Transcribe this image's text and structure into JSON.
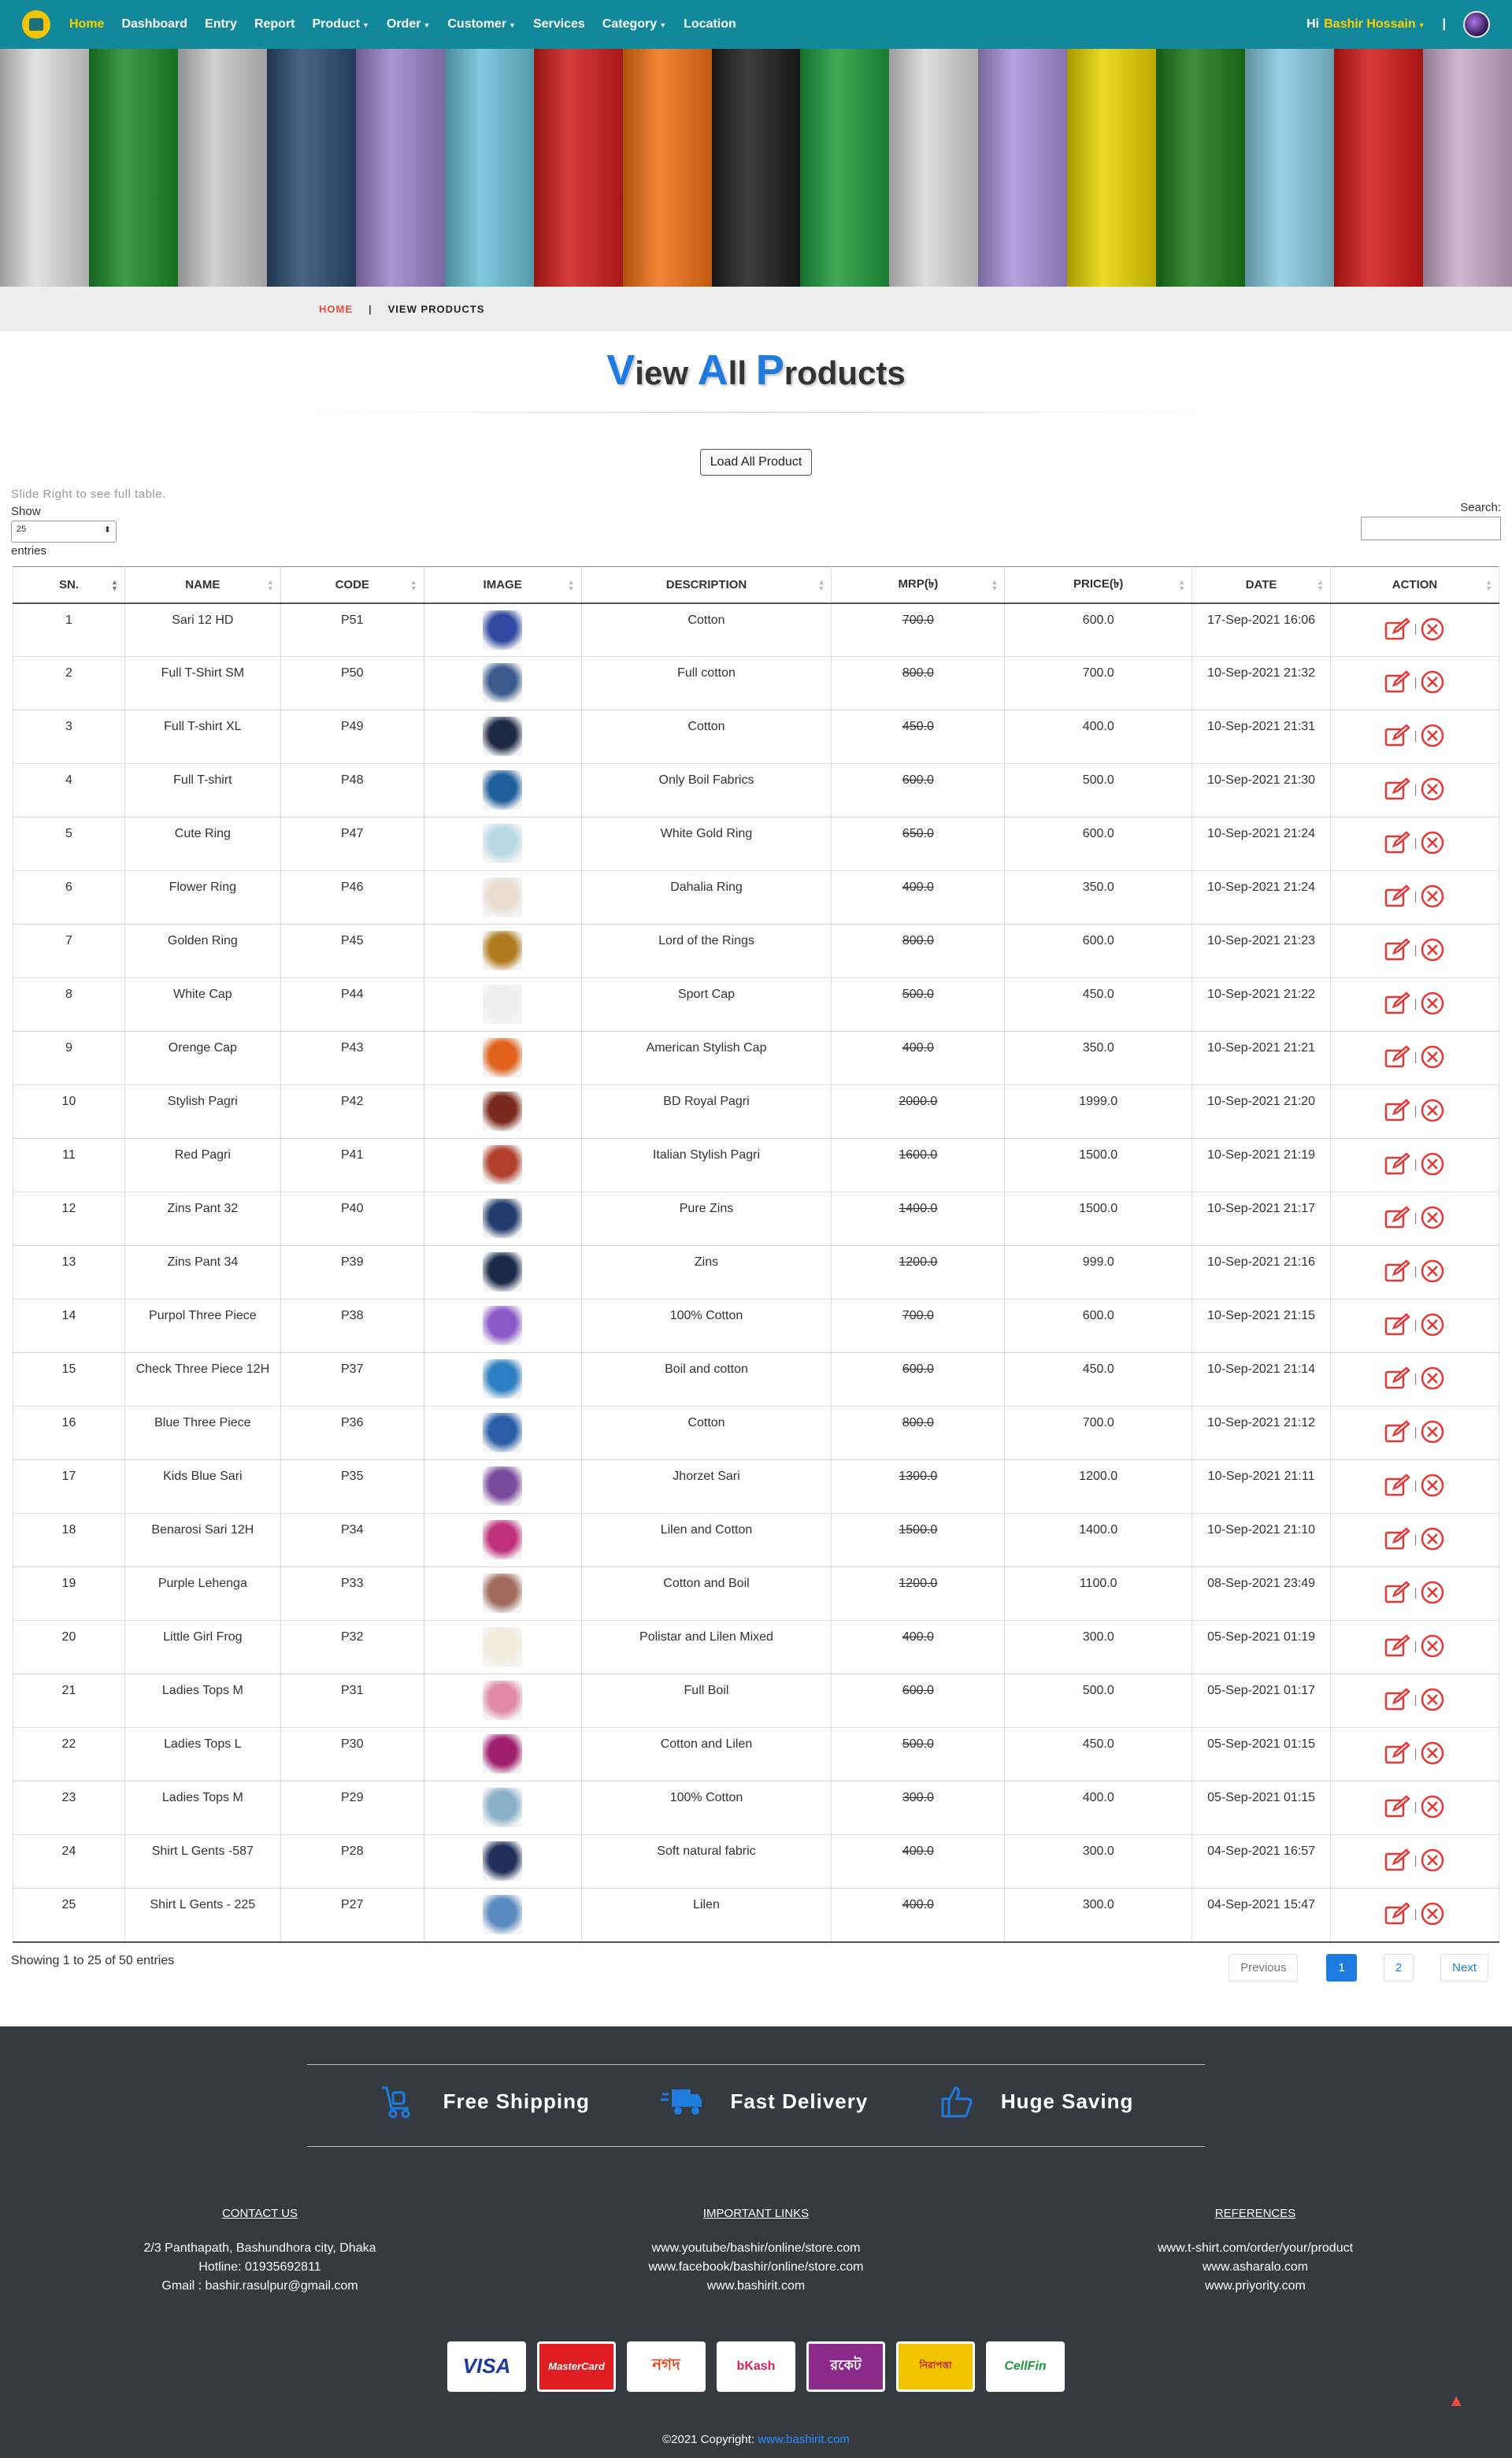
{
  "nav": {
    "items": [
      {
        "label": "Home",
        "active": true,
        "dropdown": false
      },
      {
        "label": "Dashboard",
        "active": false,
        "dropdown": false
      },
      {
        "label": "Entry",
        "active": false,
        "dropdown": false
      },
      {
        "label": "Report",
        "active": false,
        "dropdown": false
      },
      {
        "label": "Product",
        "active": false,
        "dropdown": true
      },
      {
        "label": "Order",
        "active": false,
        "dropdown": true
      },
      {
        "label": "Customer",
        "active": false,
        "dropdown": true
      },
      {
        "label": "Services",
        "active": false,
        "dropdown": false
      },
      {
        "label": "Category",
        "active": false,
        "dropdown": true
      },
      {
        "label": "Location",
        "active": false,
        "dropdown": false
      }
    ],
    "greeting": "Hi",
    "user": "Bashir Hossain",
    "separator": "|"
  },
  "breadcrumb": {
    "home": "HOME",
    "sep": "|",
    "current": "VIEW PRODUCTS"
  },
  "title": {
    "w1cap": "V",
    "w1rest": "iew ",
    "w2cap": "A",
    "w2rest": "ll ",
    "w3cap": "P",
    "w3rest": "roducts"
  },
  "load_button": "Load All Product",
  "controls": {
    "hint": "Slide Right to see full table.",
    "show": "Show",
    "length": "25",
    "entries": "entries",
    "search": "Search:"
  },
  "columns": [
    "SN.",
    "NAME",
    "CODE",
    "IMAGE",
    "DESCRIPTION",
    "MRP(৳)",
    "PRICE(৳)",
    "DATE",
    "ACTION"
  ],
  "products": [
    {
      "sn": "1",
      "name": "Sari 12 HD",
      "code": "P51",
      "desc": "Cotton",
      "mrp": "700.0",
      "price": "600.0",
      "date": "17-Sep-2021 16:06",
      "color": "#2f4aa0"
    },
    {
      "sn": "2",
      "name": "Full T-Shirt SM",
      "code": "P50",
      "desc": "Full cotton",
      "mrp": "800.0",
      "price": "700.0",
      "date": "10-Sep-2021 21:32",
      "color": "#3a5b8c"
    },
    {
      "sn": "3",
      "name": "Full T-shirt XL",
      "code": "P49",
      "desc": "Cotton",
      "mrp": "450.0",
      "price": "400.0",
      "date": "10-Sep-2021 21:31",
      "color": "#1e2a44"
    },
    {
      "sn": "4",
      "name": "Full T-shirt",
      "code": "P48",
      "desc": "Only Boil Fabrics",
      "mrp": "600.0",
      "price": "500.0",
      "date": "10-Sep-2021 21:30",
      "color": "#1f5f9c"
    },
    {
      "sn": "5",
      "name": "Cute Ring",
      "code": "P47",
      "desc": "White Gold Ring",
      "mrp": "650.0",
      "price": "600.0",
      "date": "10-Sep-2021 21:24",
      "color": "#b9d9e6"
    },
    {
      "sn": "6",
      "name": "Flower Ring",
      "code": "P46",
      "desc": "Dahalia Ring",
      "mrp": "400.0",
      "price": "350.0",
      "date": "10-Sep-2021 21:24",
      "color": "#e8dccf"
    },
    {
      "sn": "7",
      "name": "Golden Ring",
      "code": "P45",
      "desc": "Lord of the Rings",
      "mrp": "800.0",
      "price": "600.0",
      "date": "10-Sep-2021 21:23",
      "color": "#b07a1e"
    },
    {
      "sn": "8",
      "name": "White Cap",
      "code": "P44",
      "desc": "Sport Cap",
      "mrp": "500.0",
      "price": "450.0",
      "date": "10-Sep-2021 21:22",
      "color": "#eeeeee"
    },
    {
      "sn": "9",
      "name": "Orenge Cap",
      "code": "P43",
      "desc": "American Stylish Cap",
      "mrp": "400.0",
      "price": "350.0",
      "date": "10-Sep-2021 21:21",
      "color": "#e0621c"
    },
    {
      "sn": "10",
      "name": "Stylish Pagri",
      "code": "P42",
      "desc": "BD Royal Pagri",
      "mrp": "2000.0",
      "price": "1999.0",
      "date": "10-Sep-2021 21:20",
      "color": "#7a2a1c"
    },
    {
      "sn": "11",
      "name": "Red Pagri",
      "code": "P41",
      "desc": "Italian Stylish Pagri",
      "mrp": "1600.0",
      "price": "1500.0",
      "date": "10-Sep-2021 21:19",
      "color": "#b0402c"
    },
    {
      "sn": "12",
      "name": "Zins Pant 32",
      "code": "P40",
      "desc": "Pure Zins",
      "mrp": "1400.0",
      "price": "1500.0",
      "date": "10-Sep-2021 21:17",
      "color": "#233e6e"
    },
    {
      "sn": "13",
      "name": "Zins Pant 34",
      "code": "P39",
      "desc": "Zins",
      "mrp": "1200.0",
      "price": "999.0",
      "date": "10-Sep-2021 21:16",
      "color": "#1c2a4a"
    },
    {
      "sn": "14",
      "name": "Purpol Three Piece",
      "code": "P38",
      "desc": "100% Cotton",
      "mrp": "700.0",
      "price": "600.0",
      "date": "10-Sep-2021 21:15",
      "color": "#8a5ac8"
    },
    {
      "sn": "15",
      "name": "Check Three Piece 12H",
      "code": "P37",
      "desc": "Boil and cotton",
      "mrp": "600.0",
      "price": "450.0",
      "date": "10-Sep-2021 21:14",
      "color": "#2b7fc2"
    },
    {
      "sn": "16",
      "name": "Blue Three Piece",
      "code": "P36",
      "desc": "Cotton",
      "mrp": "800.0",
      "price": "700.0",
      "date": "10-Sep-2021 21:12",
      "color": "#2a5fa8"
    },
    {
      "sn": "17",
      "name": "Kids Blue Sari",
      "code": "P35",
      "desc": "Jhorzet Sari",
      "mrp": "1300.0",
      "price": "1200.0",
      "date": "10-Sep-2021 21:11",
      "color": "#7a4a9c"
    },
    {
      "sn": "18",
      "name": "Benarosi Sari 12H",
      "code": "P34",
      "desc": "Lilen and Cotton",
      "mrp": "1500.0",
      "price": "1400.0",
      "date": "10-Sep-2021 21:10",
      "color": "#c0307a"
    },
    {
      "sn": "19",
      "name": "Purple Lehenga",
      "code": "P33",
      "desc": "Cotton and Boil",
      "mrp": "1200.0",
      "price": "1100.0",
      "date": "08-Sep-2021 23:49",
      "color": "#a06a5c"
    },
    {
      "sn": "20",
      "name": "Little Girl Frog",
      "code": "P32",
      "desc": "Polistar and Lilen Mixed",
      "mrp": "400.0",
      "price": "300.0",
      "date": "05-Sep-2021 01:19",
      "color": "#f1ead8"
    },
    {
      "sn": "21",
      "name": "Ladies Tops M",
      "code": "P31",
      "desc": "Full Boil",
      "mrp": "600.0",
      "price": "500.0",
      "date": "05-Sep-2021 01:17",
      "color": "#e08aa8"
    },
    {
      "sn": "22",
      "name": "Ladies Tops L",
      "code": "P30",
      "desc": "Cotton and Lilen",
      "mrp": "500.0",
      "price": "450.0",
      "date": "05-Sep-2021 01:15",
      "color": "#a01e6e"
    },
    {
      "sn": "23",
      "name": "Ladies Tops M",
      "code": "P29",
      "desc": "100% Cotton",
      "mrp": "300.0",
      "price": "400.0",
      "date": "05-Sep-2021 01:15",
      "color": "#8ab0c8"
    },
    {
      "sn": "24",
      "name": "Shirt L Gents -587",
      "code": "P28",
      "desc": "Soft natural fabric",
      "mrp": "400.0",
      "price": "300.0",
      "date": "04-Sep-2021 16:57",
      "color": "#1f2e5a"
    },
    {
      "sn": "25",
      "name": "Shirt L Gents - 225",
      "code": "P27",
      "desc": "Lilen",
      "mrp": "400.0",
      "price": "300.0",
      "date": "04-Sep-2021 15:47",
      "color": "#5a8ac0"
    }
  ],
  "table_info": "Showing 1 to 25 of 50 entries",
  "pagination": {
    "prev": "Previous",
    "pages": [
      "1",
      "2"
    ],
    "current": "1",
    "next": "Next"
  },
  "features": [
    "Free Shipping",
    "Fast Delivery",
    "Huge Saving"
  ],
  "footer": {
    "contact": {
      "title": "CONTACT US",
      "lines": [
        "2/3 Panthapath, Bashundhora city, Dhaka",
        "Hotline: 01935692811",
        "Gmail : bashir.rasulpur@gmail.com"
      ]
    },
    "links": {
      "title": "IMPORTANT LINKS",
      "lines": [
        "www.youtube/bashir/online/store.com",
        "www.facebook/bashir/online/store.com",
        "www.bashirit.com"
      ]
    },
    "refs": {
      "title": "REFERENCES",
      "lines": [
        "www.t-shirt.com/order/your/product",
        "www.asharalo.com",
        "www.priyority.com"
      ]
    },
    "payments": [
      "VISA",
      "MasterCard",
      "নগদ",
      "bKash",
      "রকেট",
      "নিরাপত্তা",
      "CellFin"
    ],
    "copyright_text": "©2021 Copyright:",
    "copyright_link": "www.bashirit.com"
  },
  "colors": {
    "nav": "#12899a",
    "accent": "#ffd000",
    "blue": "#1e7be0",
    "red": "#e74c3c",
    "footer": "#343a40"
  },
  "icons": [
    "edit-icon",
    "delete-icon",
    "shipping-icon",
    "delivery-truck-icon",
    "thumbs-up-icon",
    "arrow-up-icon"
  ]
}
